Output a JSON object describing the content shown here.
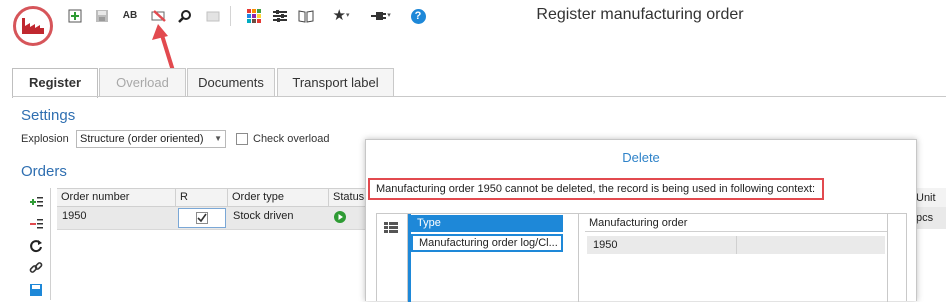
{
  "window": {
    "title": "Register manufacturing order"
  },
  "toolbar": {
    "icons": [
      "new-icon",
      "save-icon",
      "spellcheck-icon",
      "delete-icon",
      "search-icon",
      "print-icon",
      "apps-grid-icon",
      "settings-sliders-icon",
      "book-icon",
      "star-icon",
      "plugin-icon",
      "help-icon"
    ],
    "spellcheck_glyph": "AB",
    "help_glyph": "?",
    "highlight_color": "#e24a4f",
    "accent_color": "#2f83c9"
  },
  "tabs": [
    {
      "label": "Register",
      "state": "active"
    },
    {
      "label": "Overload",
      "state": "disabled"
    },
    {
      "label": "Documents",
      "state": "normal"
    },
    {
      "label": "Transport label",
      "state": "normal"
    }
  ],
  "settings": {
    "title": "Settings",
    "explosion_label": "Explosion",
    "explosion_value": "Structure (order oriented)",
    "check_overload_label": "Check overload",
    "check_overload_checked": false
  },
  "orders": {
    "title": "Orders",
    "columns": [
      "Order number",
      "R",
      "Order type",
      "Status"
    ],
    "rows": [
      {
        "order_number": "1950",
        "r_checked": true,
        "order_type": "Stock driven",
        "status": "play"
      }
    ],
    "clipped_columns": [
      "Unit"
    ],
    "clipped_cell": "pcs"
  },
  "dialog": {
    "title": "Delete",
    "message": "Manufacturing order 1950 cannot be deleted, the record is being used in following context:",
    "left_header": "Type",
    "left_value": "Manufacturing order log/Cl...",
    "right_header": "Manufacturing order",
    "right_value": "1950"
  }
}
